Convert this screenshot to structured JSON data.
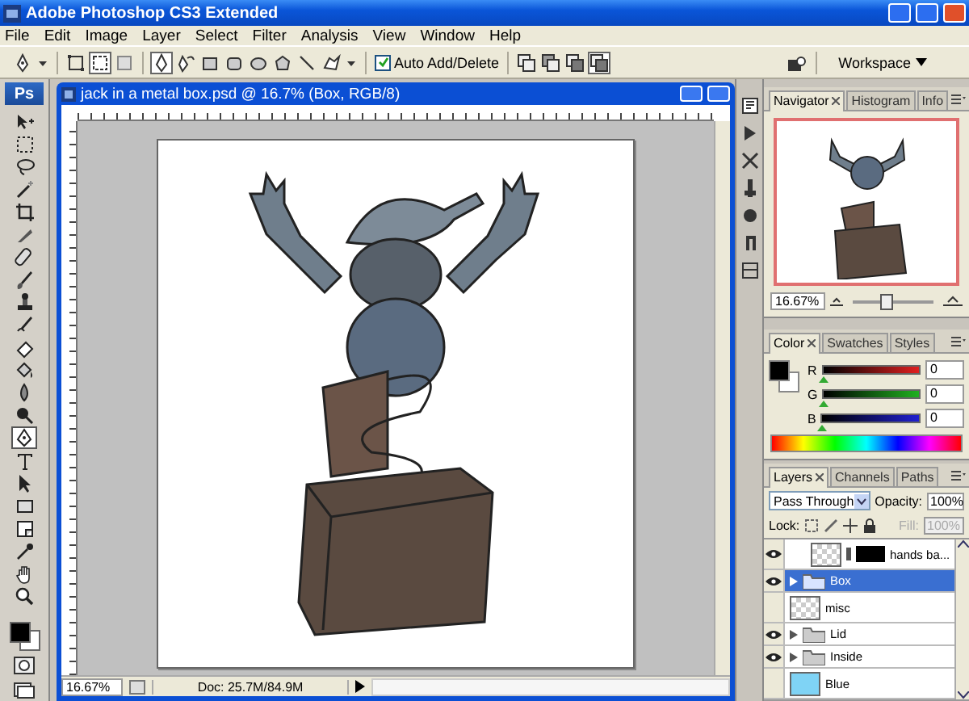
{
  "window": {
    "title": "Adobe Photoshop CS3 Extended"
  },
  "menu": [
    "File",
    "Edit",
    "Image",
    "Layer",
    "Select",
    "Filter",
    "Analysis",
    "View",
    "Window",
    "Help"
  ],
  "options_bar": {
    "auto_add_delete": {
      "label": "Auto Add/Delete",
      "checked": true
    },
    "workspace": "Workspace"
  },
  "toolbox": {
    "logo": "Ps",
    "tools": [
      {
        "kind": "move",
        "selected": false
      },
      {
        "kind": "marquee",
        "selected": false
      },
      {
        "kind": "lasso",
        "selected": false
      },
      {
        "kind": "wand",
        "selected": false
      },
      {
        "kind": "crop",
        "selected": false
      },
      {
        "kind": "slice",
        "selected": false
      },
      {
        "kind": "healing",
        "selected": false
      },
      {
        "kind": "brush",
        "selected": false
      },
      {
        "kind": "stamp",
        "selected": false
      },
      {
        "kind": "history",
        "selected": false
      },
      {
        "kind": "eraser",
        "selected": false
      },
      {
        "kind": "bucket",
        "selected": false
      },
      {
        "kind": "blur",
        "selected": false
      },
      {
        "kind": "dodge",
        "selected": false
      },
      {
        "kind": "pen",
        "selected": true
      },
      {
        "kind": "type",
        "selected": false
      },
      {
        "kind": "arrow",
        "selected": false
      },
      {
        "kind": "rect",
        "selected": false
      },
      {
        "kind": "notes",
        "selected": false
      },
      {
        "kind": "eyedropper",
        "selected": false
      },
      {
        "kind": "hand",
        "selected": false
      },
      {
        "kind": "zoom",
        "selected": false
      }
    ]
  },
  "document": {
    "title": "jack in a metal box.psd @ 16.7% (Box, RGB/8)",
    "zoom": "16.67%",
    "doc_size": "Doc: 25.7M/84.9M"
  },
  "navigator": {
    "tabs": [
      {
        "label": "Navigator",
        "selected": true
      },
      {
        "label": "Histogram",
        "selected": false
      },
      {
        "label": "Info",
        "selected": false
      }
    ],
    "zoom": "16.67%",
    "level": 0.4
  },
  "color": {
    "tabs": [
      {
        "label": "Color",
        "selected": true
      },
      {
        "label": "Swatches",
        "selected": false
      },
      {
        "label": "Styles",
        "selected": false
      }
    ],
    "channels": [
      {
        "name": "R",
        "level": 0,
        "value": "0"
      },
      {
        "name": "G",
        "level": 0,
        "value": "0"
      },
      {
        "name": "B",
        "level": 0,
        "value": "0"
      }
    ]
  },
  "layers": {
    "tabs": [
      {
        "label": "Layers",
        "selected": true
      },
      {
        "label": "Channels",
        "selected": false
      },
      {
        "label": "Paths",
        "selected": false
      }
    ],
    "blend_mode": "Pass Through",
    "opacity_label": "Opacity:",
    "opacity": "100%",
    "lock_label": "Lock:",
    "fill_label": "Fill:",
    "fill": "100%",
    "fill_disabled": true,
    "items": [
      {
        "kind": "masked",
        "name": "hands ba...",
        "visible": true,
        "selected": false
      },
      {
        "kind": "group",
        "name": "Box",
        "visible": true,
        "selected": true
      },
      {
        "kind": "layer",
        "name": "misc",
        "visible": false,
        "selected": false
      },
      {
        "kind": "group",
        "name": "Lid",
        "visible": true,
        "selected": false
      },
      {
        "kind": "group",
        "name": "Inside",
        "visible": true,
        "selected": false
      },
      {
        "kind": "fill",
        "name": "Blue",
        "visible": false,
        "selected": false,
        "color": "#7fd3f5"
      }
    ]
  }
}
